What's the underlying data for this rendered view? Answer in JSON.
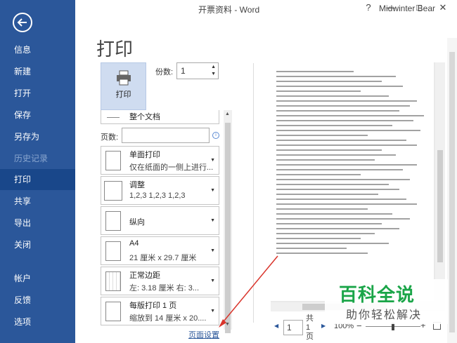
{
  "window": {
    "title": "开票资料 - Word",
    "user": "Midwinter Bear",
    "help": "?",
    "minimize": "—",
    "maximize": "□",
    "close": "✕"
  },
  "nav": {
    "items": [
      {
        "label": "信息"
      },
      {
        "label": "新建"
      },
      {
        "label": "打开"
      },
      {
        "label": "保存"
      },
      {
        "label": "另存为"
      },
      {
        "label": "历史记录"
      },
      {
        "label": "打印"
      },
      {
        "label": "共享"
      },
      {
        "label": "导出"
      },
      {
        "label": "关闭"
      },
      {
        "label": "帐户"
      },
      {
        "label": "反馈"
      },
      {
        "label": "选项"
      }
    ],
    "active": "打印",
    "disabled": "历史记录"
  },
  "print": {
    "heading": "打印",
    "button_label": "打印",
    "copies_label": "份数:",
    "copies_value": "1",
    "pages_label": "页数:",
    "pages_value": "",
    "page_setup_link": "页面设置"
  },
  "settings": {
    "print_what": {
      "title": "整个文档"
    },
    "sides": {
      "title": "单面打印",
      "subtitle": "仅在纸面的一侧上进行..."
    },
    "collate": {
      "title": "调整",
      "subtitle": "1,2,3    1,2,3    1,2,3"
    },
    "orientation": {
      "title": "纵向"
    },
    "paper": {
      "title": "A4",
      "subtitle": "21 厘米 x 29.7 厘米"
    },
    "margins": {
      "title": "正常边距",
      "subtitle": "左: 3.18 厘米    右: 3..."
    },
    "per_sheet": {
      "title": "每版打印 1 页",
      "subtitle": "缩放到 14 厘米 x 20...."
    }
  },
  "pager": {
    "current_page": "1",
    "total": "共 1 页",
    "zoom": "100%",
    "minus": "−",
    "plus": "+"
  },
  "watermark": {
    "title": "百科全说",
    "subtitle": "助你轻松解决"
  },
  "colors": {
    "nav_bg": "#2b579a",
    "nav_active": "#19478a",
    "watermark_green": "#1aa548",
    "arrow_red": "#d9342b"
  },
  "icons": {
    "back": "back-arrow-icon",
    "print": "printer-icon",
    "info": "info-icon"
  }
}
